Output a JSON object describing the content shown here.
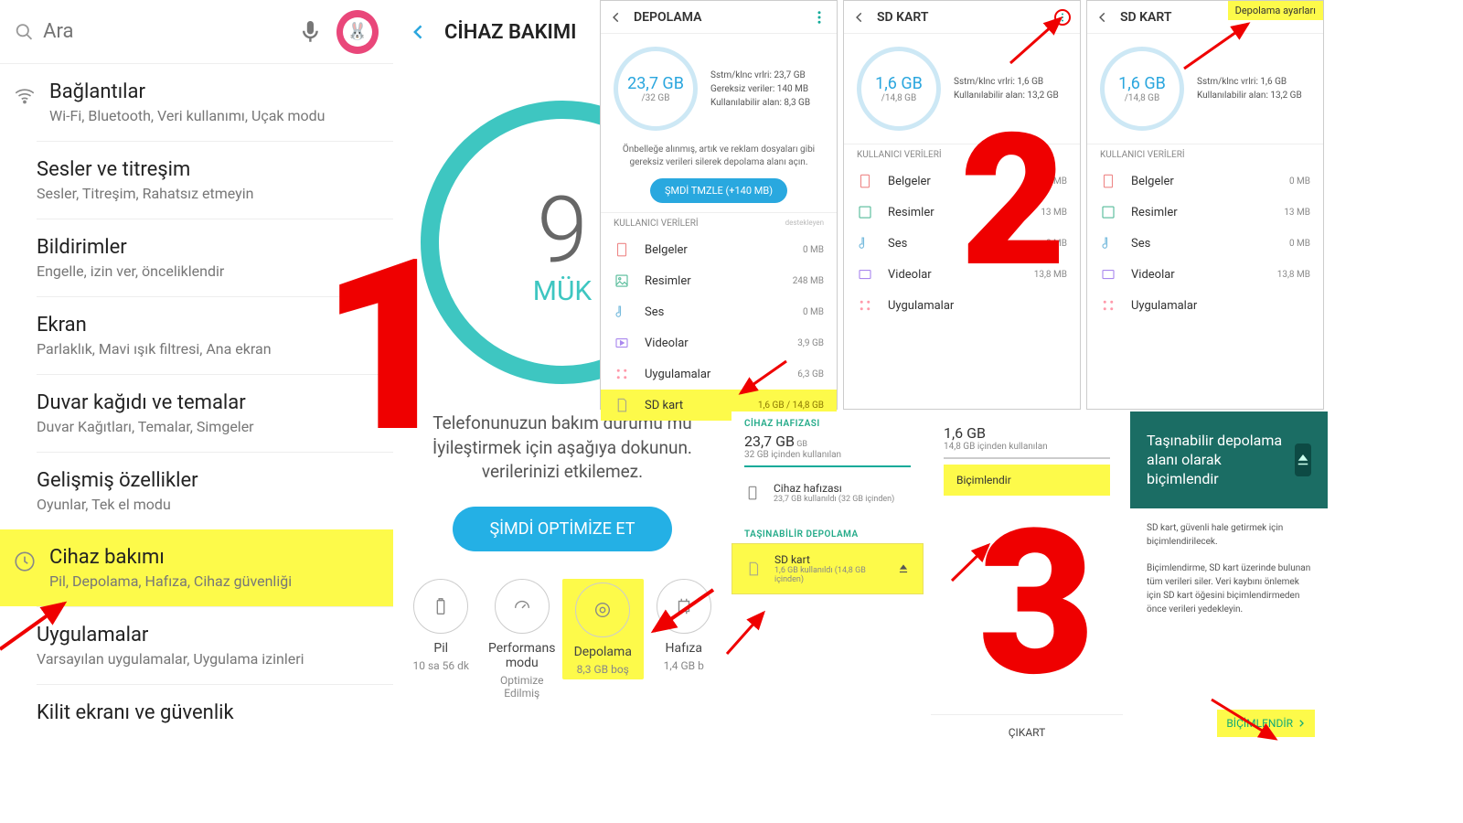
{
  "panel1": {
    "search_placeholder": "Ara",
    "items": [
      {
        "title": "Bağlantılar",
        "sub": "Wi-Fi, Bluetooth, Veri kullanımı, Uçak modu"
      },
      {
        "title": "Sesler ve titreşim",
        "sub": "Sesler, Titreşim, Rahatsız etmeyin"
      },
      {
        "title": "Bildirimler",
        "sub": "Engelle, izin ver, önceliklendir"
      },
      {
        "title": "Ekran",
        "sub": "Parlaklık, Mavi ışık filtresi, Ana ekran"
      },
      {
        "title": "Duvar kağıdı ve temalar",
        "sub": "Duvar Kağıtları, Temalar, Simgeler"
      },
      {
        "title": "Gelişmiş özellikler",
        "sub": "Oyunlar, Tek el modu"
      },
      {
        "title": "Cihaz bakımı",
        "sub": "Pil, Depolama, Hafıza, Cihaz güvenliği"
      },
      {
        "title": "Uygulamalar",
        "sub": "Varsayılan uygulamalar, Uygulama izinleri"
      },
      {
        "title": "Kilit ekranı ve güvenlik",
        "sub": ""
      }
    ]
  },
  "panel2": {
    "title": "CİHAZ BAKIMI",
    "score": "9",
    "status": "MÜK",
    "paragraph": "Telefonunuzun bakım durumu mü\nİyileştirmek için aşağıya dokunun.\nverilerinizi etkilemez.",
    "optimize": "ŞİMDİ OPTİMİZE ET",
    "tiles": [
      {
        "label": "Pil",
        "sub": "10 sa 56 dk"
      },
      {
        "label": "Performans modu",
        "sub": "Optimize Edilmiş"
      },
      {
        "label": "Depolama",
        "sub": "8,3 GB boş"
      },
      {
        "label": "Hafıza",
        "sub": "1,4 GB b"
      }
    ]
  },
  "panel3a": {
    "title": "DEPOLAMA",
    "used": "23,7 GB",
    "total": "/32 GB",
    "info1": "Sstm/klnc vrlri: 23,7 GB",
    "info2": "Gereksiz veriler: 140 MB",
    "info3": "Kullanılabilir alan: 8,3 GB",
    "clean_note": "Önbelleğe alınmış, artık ve reklam dosyaları gibi gereksiz verileri silerek depolama alanı açın.",
    "clean_btn": "ŞMDİ TMZLE (+140 MB)",
    "section": "KULLANICI VERİLERİ",
    "sponsor": "destekleyen",
    "categories": [
      {
        "label": "Belgeler",
        "size": "0 MB"
      },
      {
        "label": "Resimler",
        "size": "248 MB"
      },
      {
        "label": "Ses",
        "size": "0 MB"
      },
      {
        "label": "Videolar",
        "size": "3,9 GB"
      },
      {
        "label": "Uygulamalar",
        "size": "6,3 GB"
      },
      {
        "label": "SD kart",
        "size": "1,6 GB / 14,8 GB"
      }
    ]
  },
  "panel3b": {
    "title": "SD KART",
    "used": "1,6 GB",
    "total": "/14,8 GB",
    "info1": "Sstm/klnc vrlri: 1,6 GB",
    "info2": "Kullanılabilir alan: 13,2 GB",
    "section": "KULLANICI VERİLERİ",
    "categories": [
      {
        "label": "Belgeler",
        "size": "0 MB"
      },
      {
        "label": "Resimler",
        "size": "13 MB"
      },
      {
        "label": "Ses",
        "size": "0 MB"
      },
      {
        "label": "Videolar",
        "size": "13,8 MB"
      },
      {
        "label": "Uygulamalar",
        "size": ""
      }
    ]
  },
  "panel3c": {
    "title": "SD KART",
    "menu": "Depolama ayarları",
    "used": "1,6 GB",
    "total": "/14,8 GB",
    "info1": "Sstm/klnc vrlri: 1,6 GB",
    "info2": "Kullanılabilir alan: 13,2 GB",
    "section": "KULLANICI VERİLERİ",
    "categories": [
      {
        "label": "Belgeler",
        "size": "0 MB"
      },
      {
        "label": "Resimler",
        "size": "13 MB"
      },
      {
        "label": "Ses",
        "size": "0 MB"
      },
      {
        "label": "Videolar",
        "size": "13,8 MB"
      },
      {
        "label": "Uygulamalar",
        "size": ""
      }
    ]
  },
  "panel6": {
    "section1": "CİHAZ HAFIZASI",
    "v1": "23,7 GB",
    "s1": "32 GB içinden kullanılan",
    "dev_t": "Cihaz hafızası",
    "dev_s": "23,7 GB kullanıldı (32 GB içinden)",
    "section2": "TAŞINABİLİR DEPOLAMA",
    "sd_t": "SD kart",
    "sd_s": "1,6 GB kullanıldı (14,8 GB içinden)"
  },
  "panel7": {
    "v1": "1,6 GB",
    "s1": "14,8 GB içinden kullanılan",
    "format": "Biçimlendir",
    "bottom": "ÇIKART"
  },
  "panel8": {
    "teal_title": "Taşınabilir depolama alanı olarak biçimlendir",
    "body1": "SD kart, güvenli hale getirmek için biçimlendirilecek.",
    "body2": "Biçimlendirme, SD kart üzerinde bulunan tüm verileri siler. Veri kaybını önlemek için SD kart öğesini biçimlendirmeden önce verileri yedekleyin.",
    "fmt": "BİÇİMLENDİR"
  },
  "step1": "1",
  "step2": "2",
  "step3": "3"
}
